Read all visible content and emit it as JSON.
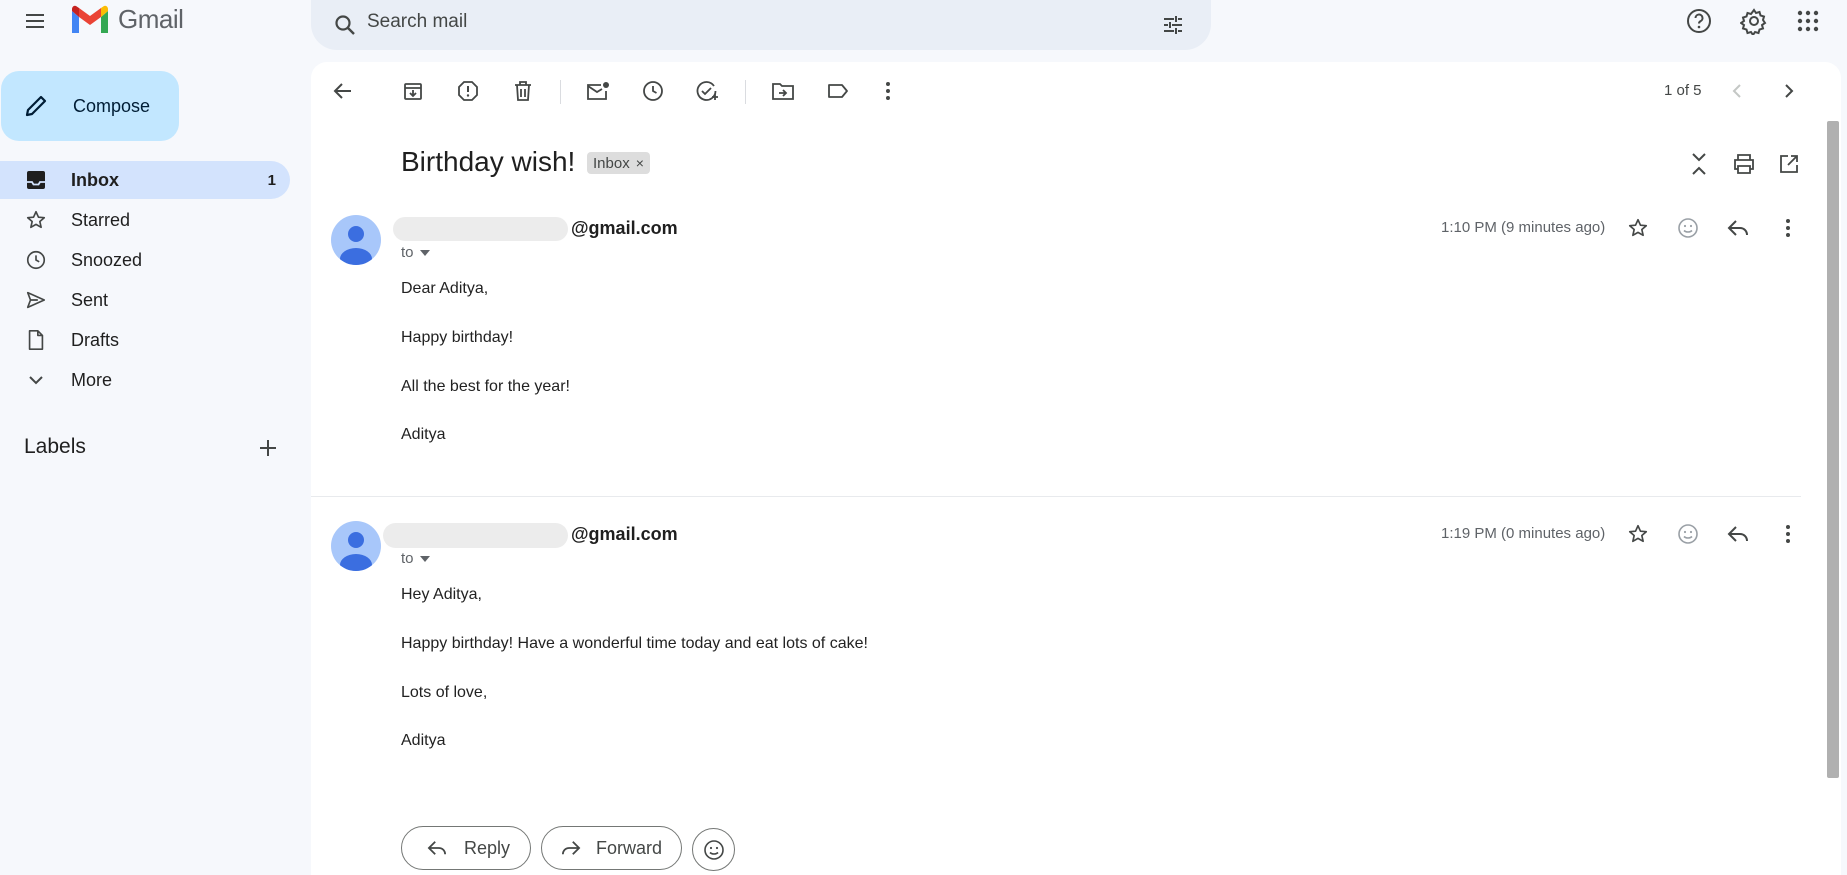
{
  "app": {
    "name": "Gmail"
  },
  "search": {
    "placeholder": "Search mail"
  },
  "sidebar": {
    "compose_label": "Compose",
    "items": [
      {
        "label": "Inbox",
        "count": "1"
      },
      {
        "label": "Starred"
      },
      {
        "label": "Snoozed"
      },
      {
        "label": "Sent"
      },
      {
        "label": "Drafts"
      },
      {
        "label": "More"
      }
    ],
    "labels_title": "Labels"
  },
  "toolbar": {
    "pagination": "1 of 5"
  },
  "thread": {
    "subject": "Birthday wish!",
    "label_chip": "Inbox",
    "chip_close": "×",
    "messages": [
      {
        "sender_suffix": "@gmail.com",
        "to_label": "to",
        "time": "1:10 PM (9 minutes ago)",
        "body": [
          "Dear Aditya,",
          "Happy birthday!",
          "All the best for the year!",
          "Aditya"
        ]
      },
      {
        "sender_suffix": "@gmail.com",
        "to_label": "to",
        "time": "1:19 PM (0 minutes ago)",
        "body": [
          "Hey Aditya,",
          "Happy birthday! Have a wonderful time today and eat lots of cake!",
          "Lots of love,",
          "Aditya"
        ]
      }
    ],
    "reply_label": "Reply",
    "forward_label": "Forward"
  },
  "colors": {
    "background": "#f6f8fc",
    "compose": "#c2e7ff",
    "active_nav": "#d3e3fd",
    "avatar": "#a8c7fa",
    "avatar_figure": "#3b6ee0"
  }
}
